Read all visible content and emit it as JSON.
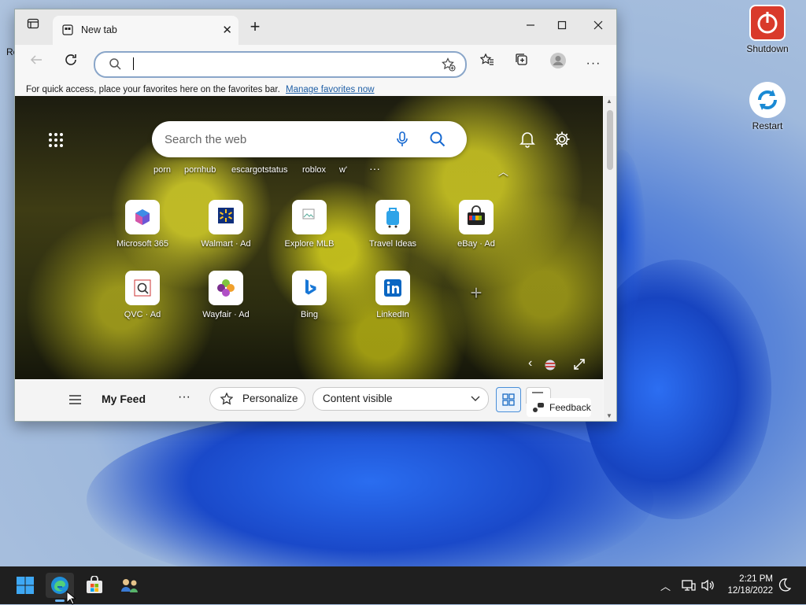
{
  "desktop": {
    "icons": [
      {
        "label": "Shutdown"
      },
      {
        "label": "Restart"
      }
    ],
    "edge_fragment": "Re"
  },
  "browser": {
    "tab_title": "New tab",
    "favorites_bar_text": "For quick access, place your favorites here on the favorites bar.",
    "favorites_bar_link": "Manage favorites now",
    "address_value": "",
    "search_placeholder": "Search the web",
    "trending": [
      "porn",
      "pornhub",
      "escargotstatus",
      "roblox",
      "w'"
    ],
    "quick_links": [
      {
        "label": "Microsoft 365",
        "icon": "m365-icon"
      },
      {
        "label": "Walmart · Ad",
        "icon": "walmart-icon"
      },
      {
        "label": "Explore MLB",
        "icon": "mlb-icon"
      },
      {
        "label": "Travel Ideas",
        "icon": "suitcase-icon"
      },
      {
        "label": "eBay · Ad",
        "icon": "ebay-icon"
      },
      {
        "label": "QVC · Ad",
        "icon": "qvc-icon"
      },
      {
        "label": "Wayfair · Ad",
        "icon": "wayfair-icon"
      },
      {
        "label": "Bing",
        "icon": "bing-icon"
      },
      {
        "label": "LinkedIn",
        "icon": "linkedin-icon"
      }
    ],
    "feed": {
      "title": "My Feed",
      "personalize": "Personalize",
      "content_select": "Content visible",
      "feedback": "Feedback"
    }
  },
  "taskbar": {
    "time": "2:21 PM",
    "date": "12/18/2022"
  }
}
